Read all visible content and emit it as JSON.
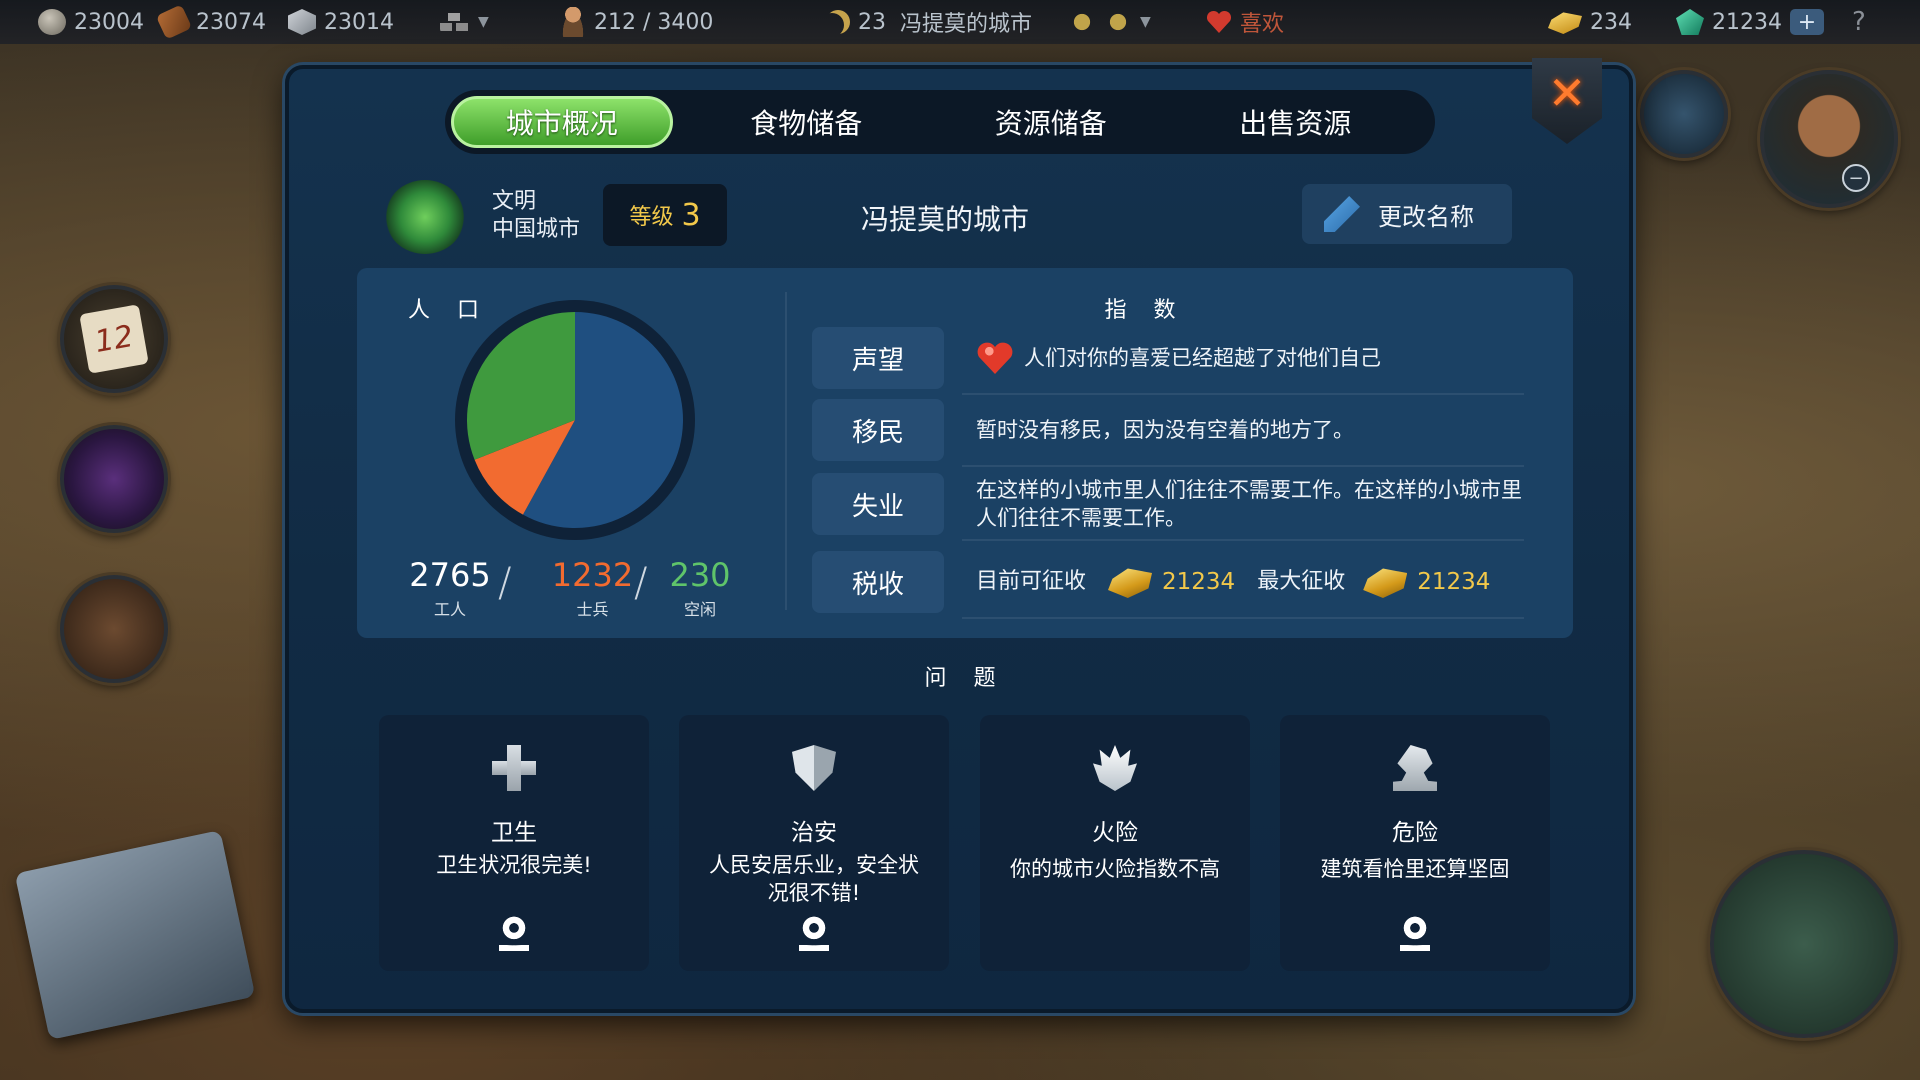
{
  "topbar": {
    "stone": "23004",
    "wood": "23074",
    "iron": "23014",
    "population": "212 / 3400",
    "turn": "23",
    "city_name": "冯提莫的城市",
    "mood": "喜欢",
    "gold": "234",
    "gems": "21234",
    "plus": "+",
    "help": "?"
  },
  "side": {
    "calendar_day": "12"
  },
  "tabs": [
    {
      "label": "城市概况",
      "active": true
    },
    {
      "label": "食物储备",
      "active": false
    },
    {
      "label": "资源储备",
      "active": false
    },
    {
      "label": "出售资源",
      "active": false
    }
  ],
  "header": {
    "civ_label": "文明",
    "civ_name": "中国城市",
    "level_label": "等级",
    "level_value": "3",
    "city_name": "冯提莫的城市",
    "rename_label": "更改名称"
  },
  "population": {
    "title": "人 口",
    "workers_value": "2765",
    "workers_label": "工人",
    "soldiers_value": "1232",
    "soldiers_label": "士兵",
    "idle_value": "230",
    "idle_label": "空闲"
  },
  "chart_data": {
    "type": "pie",
    "slices": [
      {
        "label": "工人",
        "value": 58,
        "color": "#1f4f80"
      },
      {
        "label": "士兵",
        "value": 11,
        "color": "#f26b30"
      },
      {
        "label": "空闲",
        "value": 31,
        "color": "#3f9a3e"
      }
    ],
    "title": "人 口"
  },
  "indices": {
    "title": "指 数",
    "rows": [
      {
        "label": "声望",
        "text": "人们对你的喜爱已经超越了对他们自己"
      },
      {
        "label": "移民",
        "text": "暂时没有移民，因为没有空着的地方了。"
      },
      {
        "label": "失业",
        "text": "在这样的小城市里人们往往不需要工作。在这样的小城市里人们往往不需要工作。"
      },
      {
        "label": "税收",
        "text": ""
      }
    ],
    "tax": {
      "current_label": "目前可征收",
      "current_value": "21234",
      "max_label": "最大征收",
      "max_value": "21234"
    }
  },
  "problems": {
    "title": "问 题",
    "cards": [
      {
        "name": "卫生",
        "desc": "卫生状况很完美!",
        "icon": "plus-icon"
      },
      {
        "name": "治安",
        "desc": "人民安居乐业，安全状况很不错!",
        "icon": "shield-icon"
      },
      {
        "name": "火险",
        "desc": "你的城市火险指数不高",
        "icon": "fire-icon"
      },
      {
        "name": "危险",
        "desc": "建筑看恰里还算坚固",
        "icon": "hazard-icon"
      }
    ]
  },
  "colors": {
    "workers": "#ffffff",
    "soldiers": "#f26b30",
    "idle": "#5fc46a",
    "gold_text": "#f2c84a",
    "tab_active": "#5cc13c"
  }
}
